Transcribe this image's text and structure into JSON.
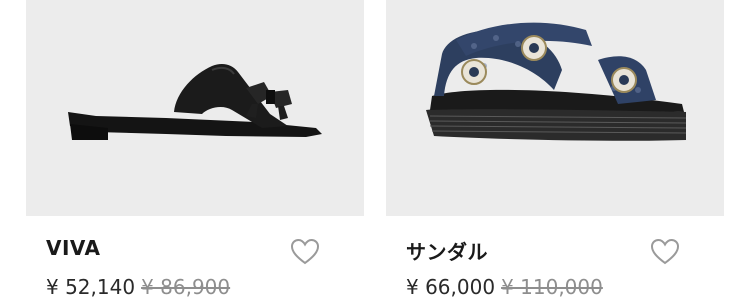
{
  "products": [
    {
      "name": "VIVA",
      "price_current": "¥ 52,140",
      "price_original": "¥ 86,900",
      "image_alt": "black-slide-sandal",
      "favorite_icon": "heart-outline-icon"
    },
    {
      "name": "サンダル",
      "price_current": "¥ 66,000",
      "price_original": "¥ 110,000",
      "image_alt": "denim-strap-sandal",
      "favorite_icon": "heart-outline-icon"
    }
  ],
  "colors": {
    "image_background": "#ececec",
    "text_primary": "#1a1a1a",
    "text_strikethrough": "#8e8e8e",
    "icon_stroke": "#9a9a9a"
  }
}
